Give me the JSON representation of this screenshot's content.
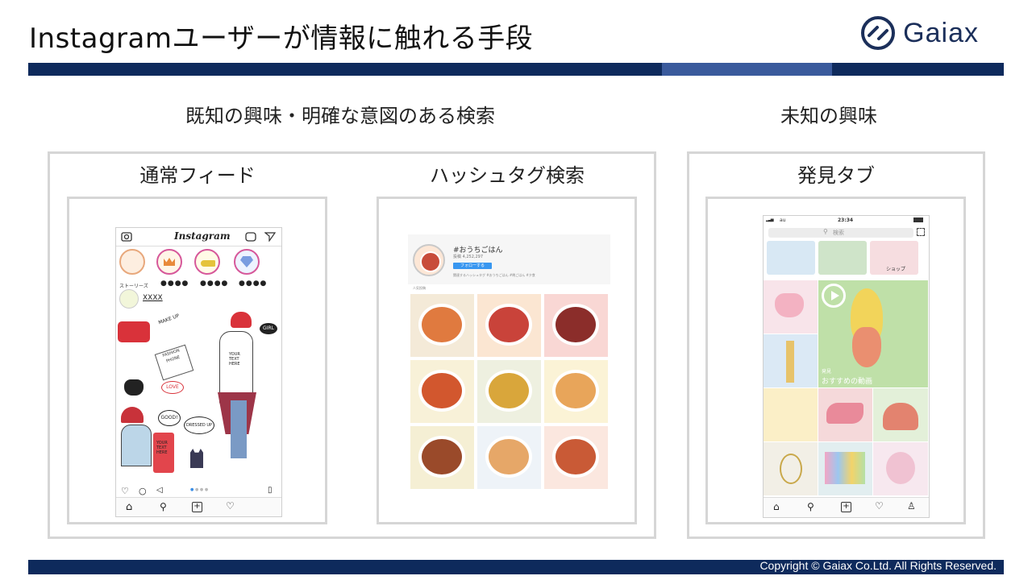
{
  "header": {
    "title": "Instagramユーザーが情報に触れる手段",
    "logo_text": "Gaiax"
  },
  "sections": {
    "known": "既知の興味・明確な意図のある検索",
    "unknown": "未知の興味"
  },
  "panels": {
    "feed": "通常フィード",
    "hashtag": "ハッシュタグ検索",
    "discover": "発見タブ"
  },
  "feed_phone": {
    "app_name": "Instagram",
    "stories_label": "ストーリーズ",
    "username": "XXXX",
    "illustration_text": [
      "MAKE UP",
      "GIRL",
      "YOUR TEXT HERE",
      "FASHION PHONE",
      "LOVE",
      "GOOD!",
      "DRESSED UP",
      "YOUR TEXT HERE"
    ]
  },
  "hashtag_phone": {
    "tag": "#おうちごはん",
    "post_count": "投稿 4,252,297",
    "follow_label": "フォローする",
    "related": "関連するハッシュタグ #おうちごはん #晩ごはん #夕食",
    "top_label": "人気投稿"
  },
  "discover_phone": {
    "carrier": "au",
    "time": "23:34",
    "search_placeholder": "検索",
    "chip_label": "ショップ",
    "video_caption": "おすすめの動画",
    "video_caption_small": "発見"
  },
  "footer": {
    "copyright": "Copyright © Gaiax Co.Ltd. All Rights Reserved."
  },
  "colors": {
    "brand_navy": "#0e2a5c",
    "brand_blue": "#3a5a9c",
    "panel_border": "#d6d6d6"
  }
}
